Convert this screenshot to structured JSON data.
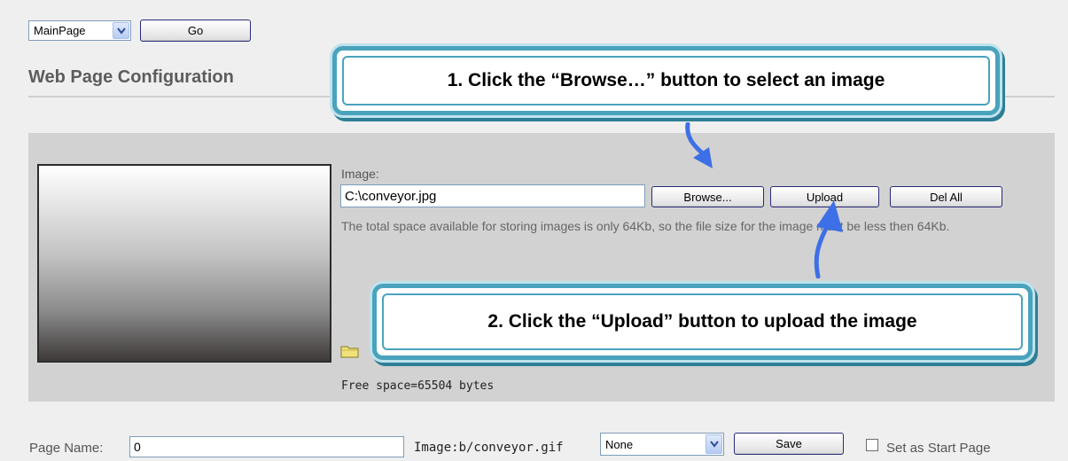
{
  "nav": {
    "page_select": "MainPage",
    "go_label": "Go"
  },
  "page_title": "Web Page Configuration",
  "image_section": {
    "image_label": "Image:",
    "file_path_value": "C:\\conveyor.jpg",
    "browse_label": "Browse...",
    "upload_label": "Upload",
    "del_all_label": "Del All",
    "note": "The total space available for storing images is only 64Kb, so the file size for the image must be less then 64Kb.",
    "free_space": "Free space=65504 bytes"
  },
  "callouts": {
    "step1": "1. Click the “Browse…” button to select an image",
    "step2": "2. Click the “Upload” button to upload the image"
  },
  "bottom": {
    "page_name_label": "Page Name:",
    "page_name_value": "0",
    "image_path": "Image:b/conveyor.gif",
    "image_select": "None",
    "save_label": "Save",
    "start_page_label": "Set as Start Page"
  },
  "colors": {
    "callout_border": "#4aa3bd",
    "arrow": "#3d6fe6",
    "panel_bg": "#d2d2d2"
  }
}
